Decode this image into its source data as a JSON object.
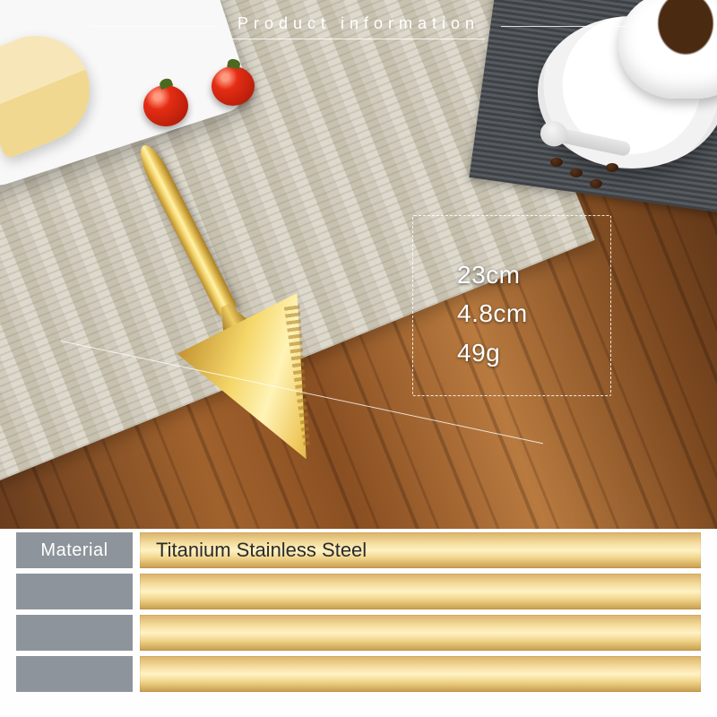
{
  "header": {
    "title": "Product information"
  },
  "dimensions": {
    "length": "23cm",
    "width": "4.8cm",
    "weight": "49g"
  },
  "spec": {
    "rows": [
      {
        "label": "Material",
        "value": "Titanium Stainless Steel"
      },
      {
        "label": "",
        "value": ""
      },
      {
        "label": "",
        "value": ""
      },
      {
        "label": "",
        "value": ""
      }
    ]
  }
}
